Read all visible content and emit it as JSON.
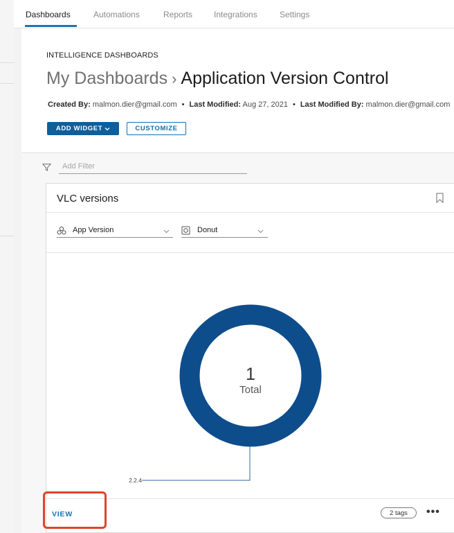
{
  "nav": {
    "tabs": [
      "Dashboards",
      "Automations",
      "Reports",
      "Integrations",
      "Settings"
    ],
    "active_tab": "Dashboards"
  },
  "header": {
    "eyebrow": "INTELLIGENCE DASHBOARDS",
    "breadcrumb": "My Dashboards",
    "separator": "›",
    "title": "Application Version Control",
    "created_by_label": "Created By:",
    "created_by": "malmon.dier@gmail.com",
    "last_modified_label": "Last Modified:",
    "last_modified": "Aug 27, 2021",
    "last_modified_by_label": "Last Modified By:",
    "last_modified_by": "malmon.dier@gmail.com",
    "add_widget_label": "ADD WIDGET",
    "customize_label": "CUSTOMIZE"
  },
  "filter": {
    "placeholder": "Add Filter",
    "icon": "filter-icon"
  },
  "widget": {
    "title": "VLC versions",
    "bookmark_icon": "bookmark-icon",
    "group_by": "App Version",
    "chart_type": "Donut",
    "view_label": "VIEW",
    "tags_label": "2 tags",
    "more_label": "•••"
  },
  "chart_data": {
    "type": "pie",
    "variant": "donut",
    "categories": [
      "2.2.4"
    ],
    "values": [
      1
    ],
    "center_value": "1",
    "center_label": "Total",
    "color": "#0e4d8c"
  },
  "colors": {
    "accent": "#1b74b6",
    "primary_button": "#0d5f9d",
    "highlight": "#e0432a",
    "donut": "#0e4d8c"
  }
}
